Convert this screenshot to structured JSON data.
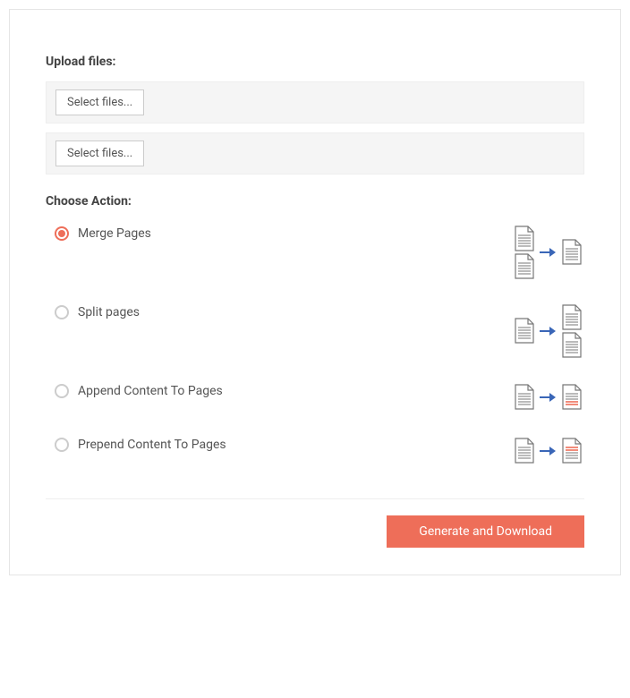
{
  "upload": {
    "label": "Upload files:",
    "select_button": "Select files..."
  },
  "actions": {
    "label": "Choose Action:",
    "items": [
      {
        "label": "Merge Pages",
        "checked": true,
        "key": "merge"
      },
      {
        "label": "Split pages",
        "checked": false,
        "key": "split"
      },
      {
        "label": "Append Content To Pages",
        "checked": false,
        "key": "append"
      },
      {
        "label": "Prepend Content To Pages",
        "checked": false,
        "key": "prepend"
      }
    ]
  },
  "footer": {
    "primary_button": "Generate and Download"
  },
  "colors": {
    "accent": "#ee6e59",
    "arrow": "#3a66b7",
    "doc_stroke": "#777"
  }
}
